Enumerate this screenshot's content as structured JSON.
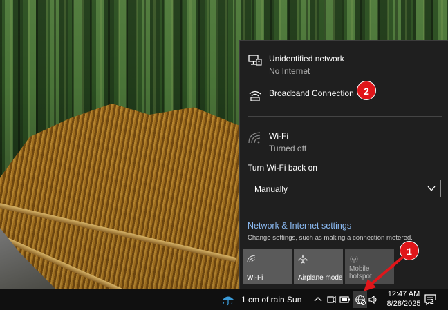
{
  "flyout": {
    "networks": [
      {
        "name": "Unidentified network",
        "status": "No Internet",
        "icon": "ethernet-monitor-icon"
      },
      {
        "name": "Broadband Connection",
        "status": "",
        "icon": "dialup-icon"
      },
      {
        "name": "Wi-Fi",
        "status": "Turned off",
        "icon": "wifi-off-icon"
      }
    ],
    "turn_wifi_label": "Turn Wi-Fi back on",
    "turn_wifi_value": "Manually",
    "settings_link": "Network & Internet settings",
    "settings_desc": "Change settings, such as making a connection metered.",
    "tiles": [
      {
        "label": "Wi-Fi",
        "icon": "wifi-icon",
        "state": "off"
      },
      {
        "label": "Airplane mode",
        "icon": "airplane-icon",
        "state": "off"
      },
      {
        "label": "Mobile hotspot",
        "icon": "hotspot-icon",
        "state": "disabled"
      }
    ]
  },
  "annotations": {
    "badge1": "1",
    "badge2": "2",
    "accent_color": "#e0161a"
  },
  "taskbar": {
    "weather": "1 cm of rain Sun",
    "time": "12:47 AM",
    "date": "8/28/2025",
    "notification_count": "2"
  },
  "colors": {
    "flyout_bg": "#1f1f1f",
    "link": "#8ab9f1",
    "tile_bg": "#5a5a5a",
    "taskbar_bg": "#101010"
  }
}
